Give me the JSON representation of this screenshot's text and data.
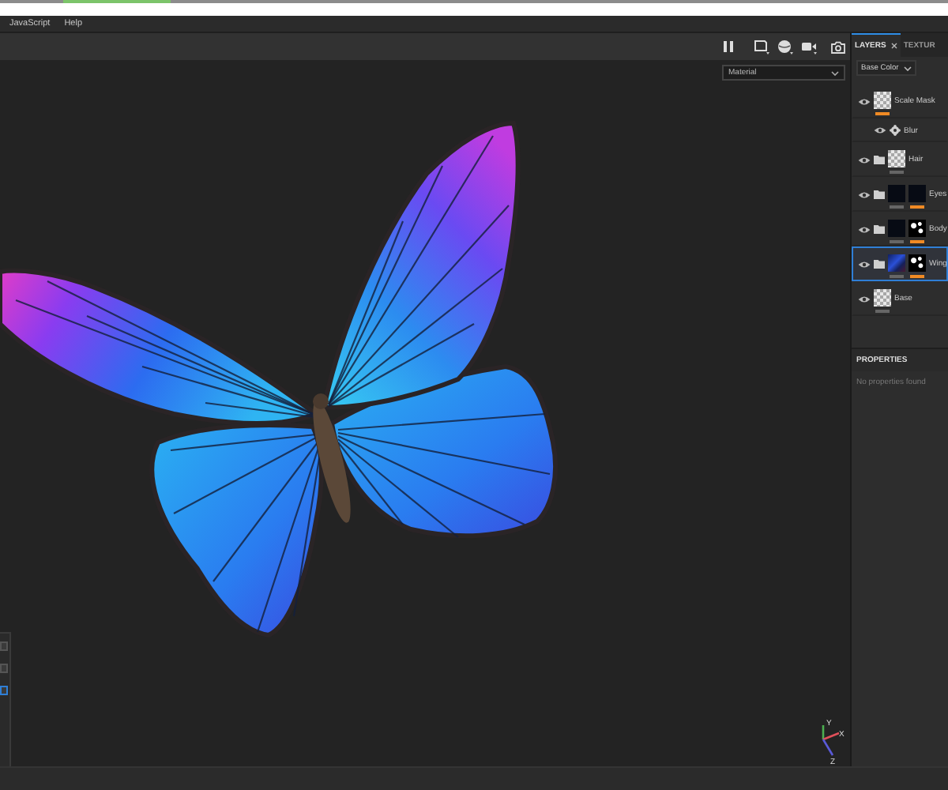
{
  "menu_bar": {
    "items": [
      "JavaScript",
      "Help"
    ]
  },
  "viewport": {
    "shading_select": {
      "value": "Material"
    },
    "side_tools": [
      {
        "selected": false
      },
      {
        "selected": false
      },
      {
        "selected": true
      }
    ],
    "axes": [
      {
        "label": "Y",
        "color": "#4caf50"
      },
      {
        "label": "X",
        "color": "#e0505a"
      },
      {
        "label": "Z",
        "color": "#5a5ad8"
      }
    ]
  },
  "panel_tabs": [
    {
      "label": "LAYERS",
      "selected": true,
      "closable": true
    },
    {
      "label": "TEXTUR",
      "selected": false,
      "closable": false
    }
  ],
  "layers": {
    "channel_select": {
      "value": "Base Color"
    },
    "items": [
      {
        "kind": "layer",
        "name": "Scale Mask",
        "visible": true,
        "selected": false,
        "thumbnails": [
          {
            "kind": "checker",
            "selected": true
          }
        ],
        "children": [
          {
            "kind": "filter",
            "name": "Blur",
            "visible": true,
            "selected": false
          }
        ]
      },
      {
        "kind": "folder",
        "name": "Hair",
        "visible": true,
        "selected": false,
        "thumbnails": [
          {
            "kind": "checker",
            "selected": false
          }
        ]
      },
      {
        "kind": "folder",
        "name": "Eyes",
        "visible": true,
        "selected": false,
        "thumbnails": [
          {
            "kind": "dark",
            "selected": false
          },
          {
            "kind": "dark",
            "selected": true
          }
        ]
      },
      {
        "kind": "folder",
        "name": "Body",
        "visible": true,
        "selected": false,
        "thumbnails": [
          {
            "kind": "dark",
            "selected": false
          },
          {
            "kind": "mask",
            "selected": true
          }
        ]
      },
      {
        "kind": "folder",
        "name": "Wing",
        "visible": true,
        "selected": true,
        "thumbnails": [
          {
            "kind": "texture",
            "selected": false
          },
          {
            "kind": "mask",
            "selected": true
          }
        ]
      },
      {
        "kind": "layer",
        "name": "Base",
        "visible": true,
        "selected": false,
        "thumbnails": [
          {
            "kind": "checker",
            "selected": false
          }
        ]
      }
    ]
  },
  "properties": {
    "title": "PROPERTIES",
    "message": "No properties found"
  }
}
